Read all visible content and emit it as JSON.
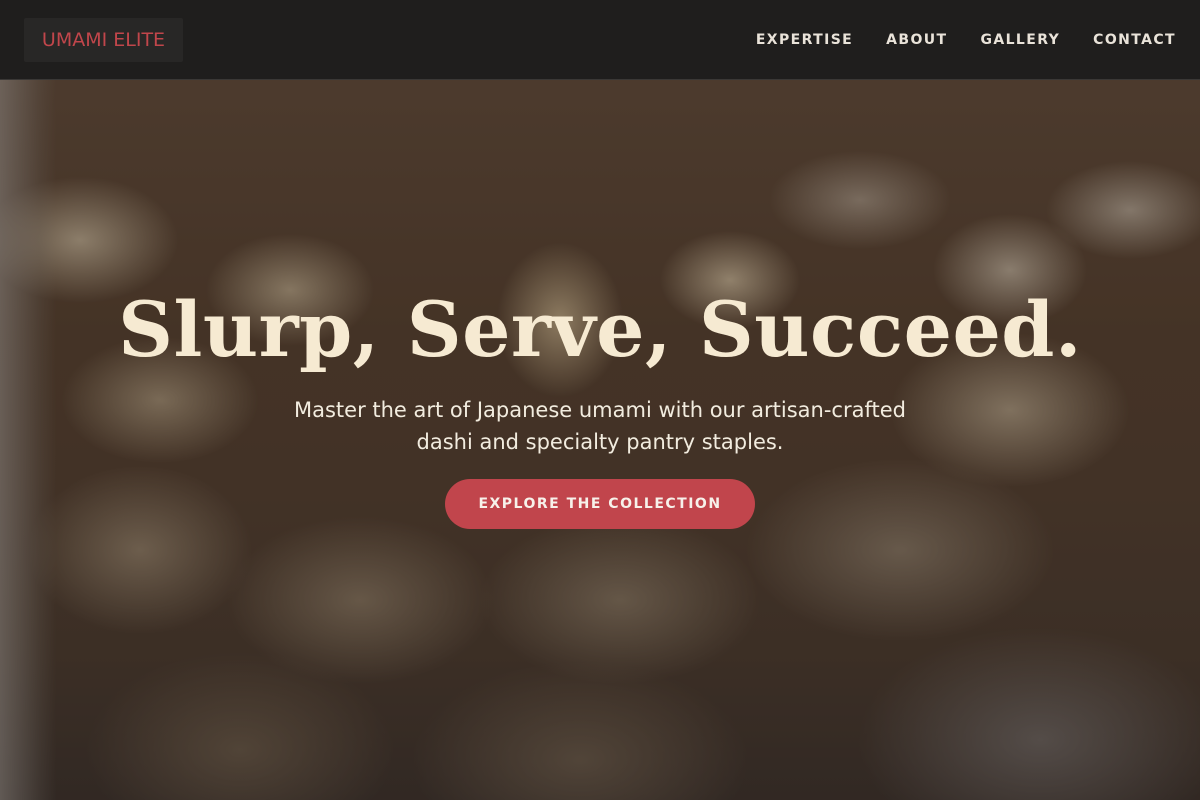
{
  "brand": {
    "name": "UMAMI ELITE"
  },
  "nav": {
    "items": [
      {
        "label": "EXPERTISE"
      },
      {
        "label": "ABOUT"
      },
      {
        "label": "GALLERY"
      },
      {
        "label": "CONTACT"
      }
    ]
  },
  "hero": {
    "title": "Slurp, Serve, Succeed.",
    "subtitle": "Master the art of Japanese umami with our artisan-crafted dashi and specialty pantry staples.",
    "cta_label": "EXPLORE THE COLLECTION"
  },
  "colors": {
    "accent": "#c1454c",
    "brand_text": "#c1464b",
    "navbar_bg": "#1f1e1d",
    "title_text": "#f6ead2"
  }
}
